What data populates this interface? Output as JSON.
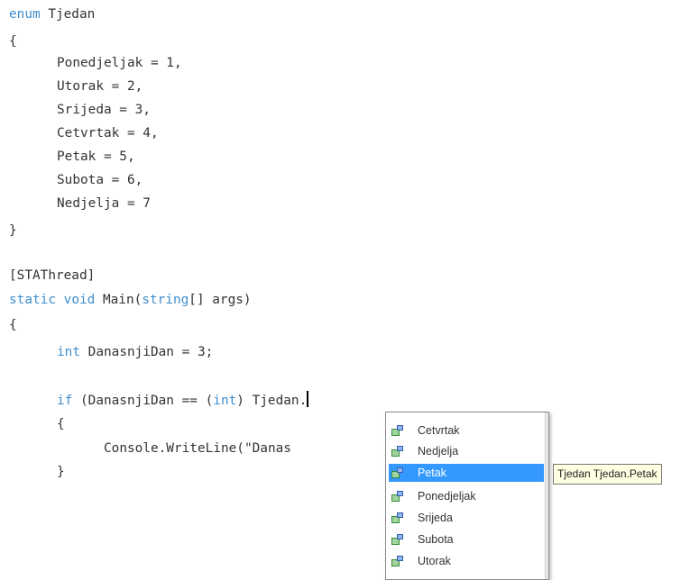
{
  "code": {
    "enum_keyword": "enum",
    "enum_name": " Tjedan",
    "open_brace_1": "{",
    "members": [
      "Ponedjeljak = 1,",
      "Utorak = 2,",
      "Srijeda = 3,",
      "Cetvrtak = 4,",
      "Petak = 5,",
      "Subota = 6,",
      "Nedjelja = 7"
    ],
    "close_brace_1": "}",
    "attribute": "[STAThread]",
    "main_static": "static",
    "main_void": "void",
    "main_name": " Main(",
    "main_string": "string",
    "main_rest": "[] args)",
    "open_brace_2": "{",
    "int_keyword": "int",
    "var_decl": " DanasnjiDan = 3;",
    "if_keyword": "if",
    "if_mid": " (DanasnjiDan == (",
    "cast_int": "int",
    "if_end": ") Tjedan.",
    "inner_open": "{",
    "writeline": "Console.WriteLine(\"Danas",
    "inner_close": "}"
  },
  "autocomplete": {
    "items": [
      "Cetvrtak",
      "Nedjelja",
      "Petak",
      "Ponedjeljak",
      "Srijeda",
      "Subota",
      "Utorak"
    ],
    "selected": "Petak",
    "icon": "enum-member-icon"
  },
  "tooltip": {
    "text": "Tjedan Tjedan.Petak"
  },
  "colors": {
    "keyword": "#3f8fce",
    "text": "#333333",
    "selection": "#3399ff",
    "tooltip_bg": "#ffffe1"
  }
}
